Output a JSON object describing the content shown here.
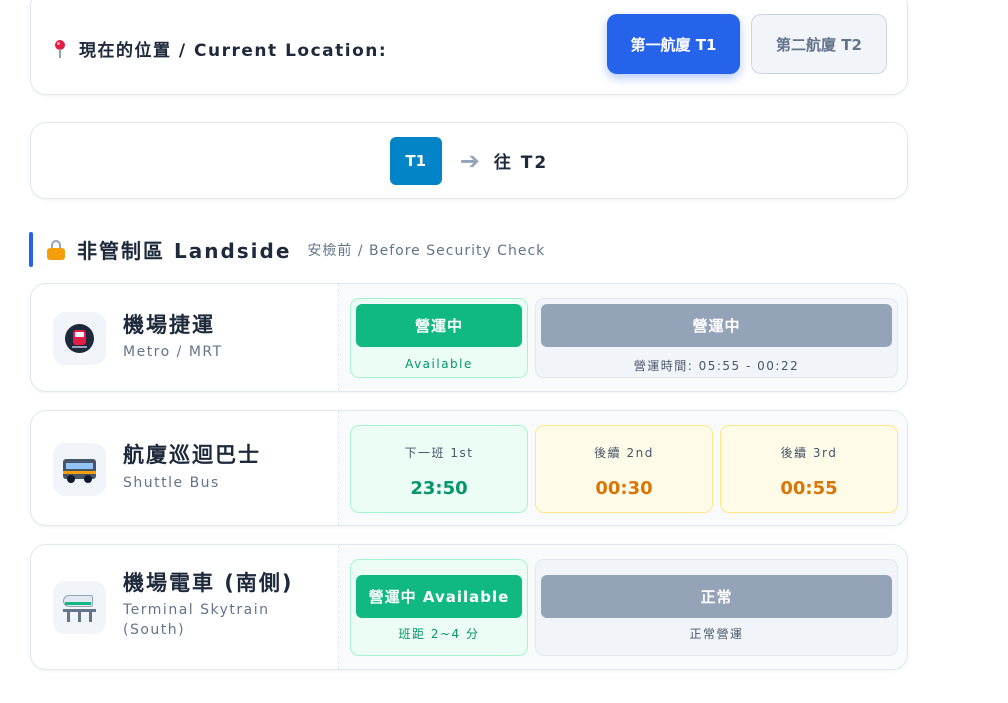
{
  "location": {
    "label": "現在的位置 / Current Location:",
    "icon": "map-pin-icon",
    "buttons": [
      {
        "label": "第一航廈 T1",
        "active": true
      },
      {
        "label": "第二航廈 T2",
        "active": false
      }
    ]
  },
  "route": {
    "from_badge": "T1",
    "arrow_icon": "arrow-right-icon",
    "to_text": "往 T2"
  },
  "section": {
    "icon": "unlock-icon",
    "title": "非管制區 Landside",
    "subtitle": "安檢前 / Before Security Check"
  },
  "transports": {
    "metro": {
      "icon": "metro-icon",
      "name": "機場捷運",
      "name_en": "Metro / MRT",
      "status": {
        "label": "營運中",
        "note": "Available"
      },
      "hours": {
        "label": "營運中",
        "note": "營運時間: 05:55 - 00:22"
      }
    },
    "bus": {
      "icon": "bus-icon",
      "name": "航廈巡迴巴士",
      "name_en": "Shuttle Bus",
      "departures": [
        {
          "label": "下一班 1st",
          "time": "23:50"
        },
        {
          "label": "後續 2nd",
          "time": "00:30"
        },
        {
          "label": "後續 3rd",
          "time": "00:55"
        }
      ]
    },
    "skytrain": {
      "icon": "skytrain-icon",
      "name": "機場電車 (南側)",
      "name_en_1": "Terminal Skytrain",
      "name_en_2": "(South)",
      "status": {
        "label": "營運中 Available",
        "note": "班距 2~4 分"
      },
      "condition": {
        "label": "正常",
        "note": "正常營運"
      }
    }
  },
  "colors": {
    "primary": "#2563eb",
    "badge": "#0284c7",
    "green": "#10b981",
    "muted": "#94a3b8",
    "orange": "#d97706"
  }
}
